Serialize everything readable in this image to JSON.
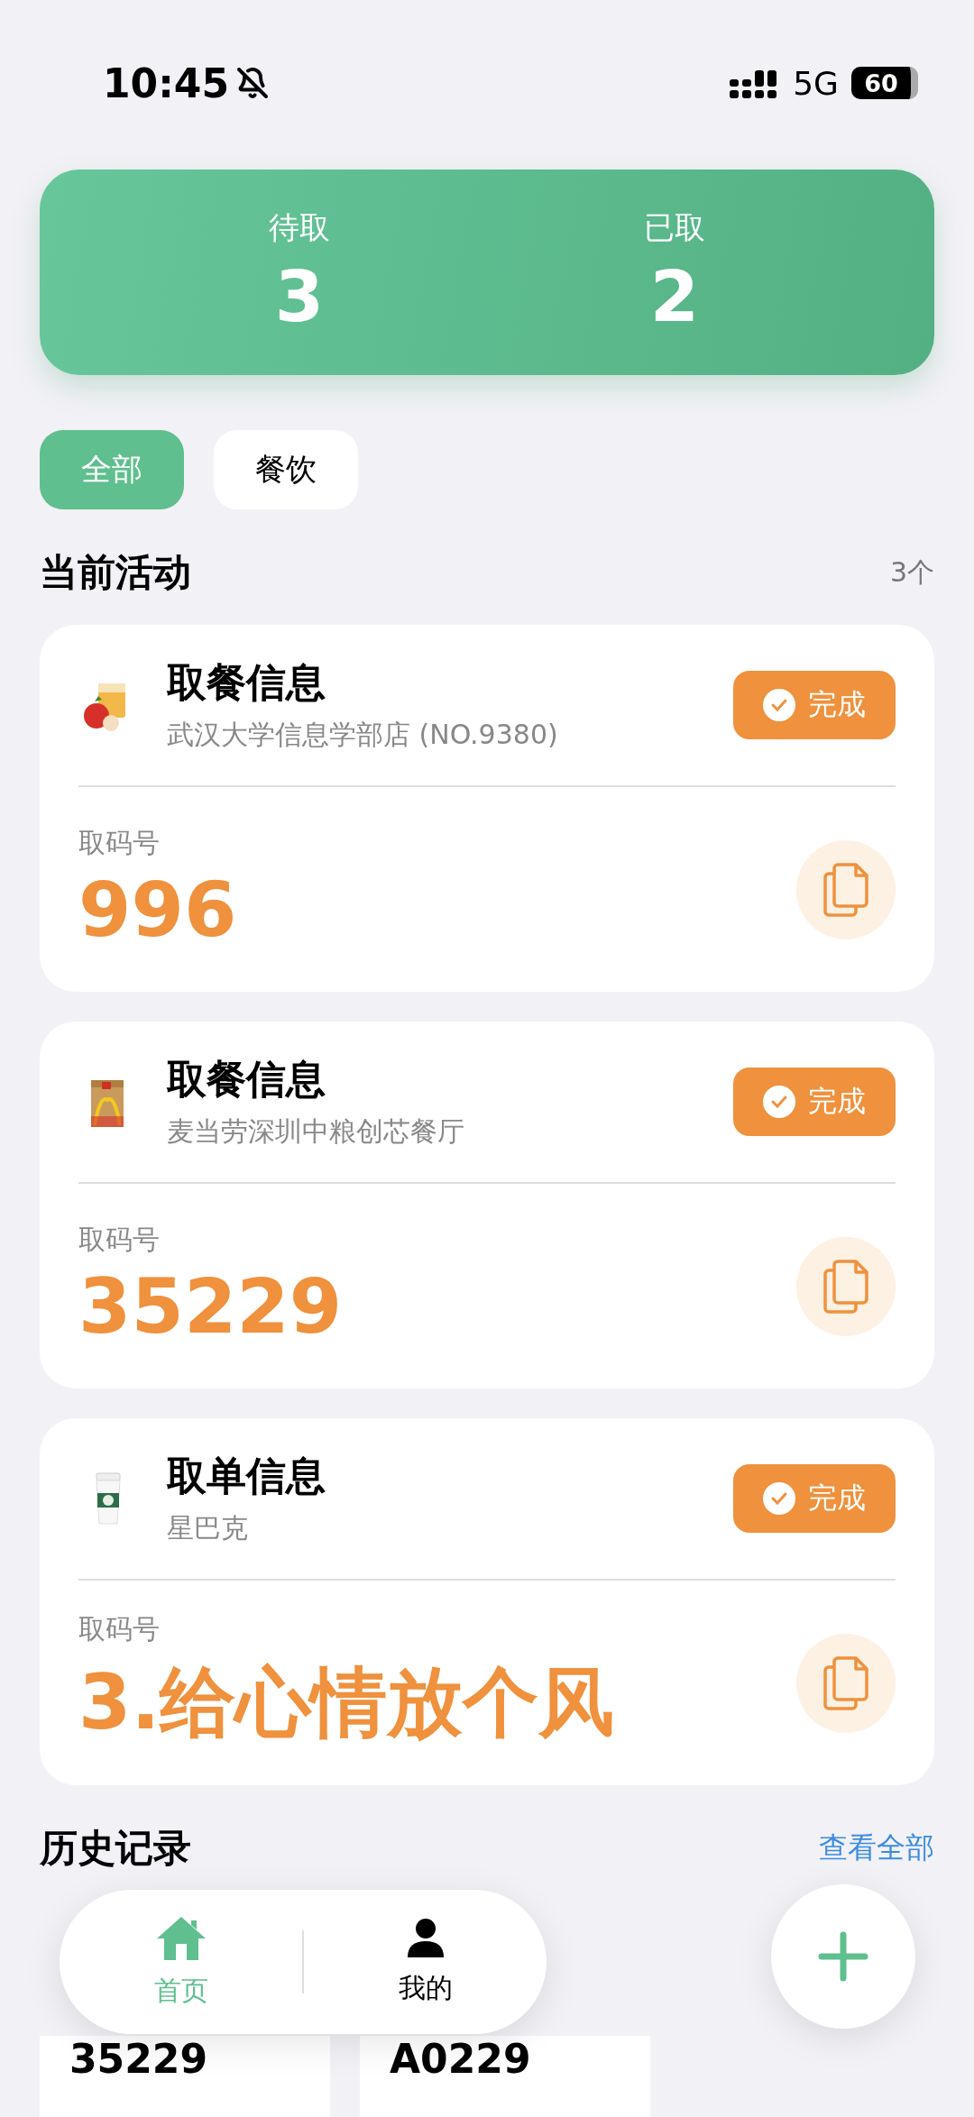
{
  "status_bar": {
    "time": "10:45",
    "network": "5G",
    "battery": "60"
  },
  "summary": [
    {
      "label": "待取",
      "count": "3"
    },
    {
      "label": "已取",
      "count": "2"
    }
  ],
  "filters": [
    {
      "label": "全部",
      "selected": true
    },
    {
      "label": "餐饮",
      "selected": false
    }
  ],
  "current": {
    "title": "当前活动",
    "count": "3个",
    "orders": [
      {
        "title": "取餐信息",
        "store": "武汉大学信息学部店 (NO.9380)",
        "status": "完成",
        "code_label": "取码号",
        "code": "996"
      },
      {
        "title": "取餐信息",
        "store": "麦当劳深圳中粮创芯餐厅",
        "status": "完成",
        "code_label": "取码号",
        "code": "35229"
      },
      {
        "title": "取单信息",
        "store": "星巴克",
        "status": "完成",
        "code_label": "取码号",
        "code": "3.给心情放个风"
      }
    ]
  },
  "history": {
    "title": "历史记录",
    "link": "查看全部",
    "items": [
      {
        "code": "35229"
      },
      {
        "code": "A0229"
      }
    ]
  },
  "nav": [
    {
      "kind": "home",
      "label": "首页",
      "selected": true
    },
    {
      "kind": "profile",
      "label": "我的",
      "selected": false
    }
  ]
}
